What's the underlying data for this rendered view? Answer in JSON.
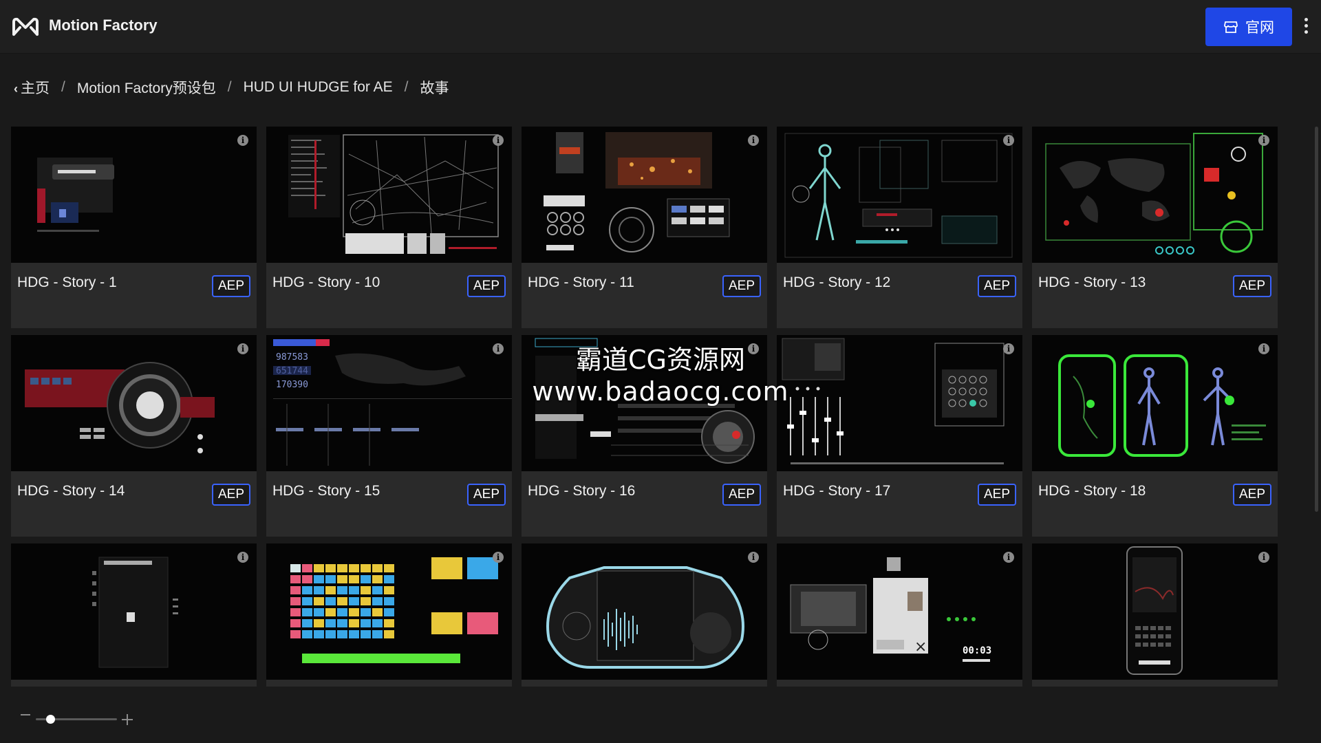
{
  "app": {
    "title": "Motion Factory",
    "logo_icon": "motion-factory-logo-icon",
    "site_button": {
      "label": "官网",
      "icon": "store-icon"
    },
    "more_icon": "kebab-menu-icon"
  },
  "breadcrumb": {
    "back_icon": "chevron-left-icon",
    "items": [
      "主页",
      "Motion Factory预设包",
      "HUD UI HUDGE for AE",
      "故事"
    ],
    "separator": "/"
  },
  "cards": [
    {
      "title": "HDG - Story - 1",
      "badge": "AEP"
    },
    {
      "title": "HDG - Story - 10",
      "badge": "AEP"
    },
    {
      "title": "HDG - Story - 11",
      "badge": "AEP"
    },
    {
      "title": "HDG - Story - 12",
      "badge": "AEP"
    },
    {
      "title": "HDG - Story - 13",
      "badge": "AEP"
    },
    {
      "title": "HDG - Story - 14",
      "badge": "AEP"
    },
    {
      "title": "HDG - Story - 15",
      "badge": "AEP"
    },
    {
      "title": "HDG - Story - 16",
      "badge": "AEP"
    },
    {
      "title": "HDG - Story - 17",
      "badge": "AEP"
    },
    {
      "title": "HDG - Story - 18",
      "badge": "AEP"
    },
    {
      "title": "",
      "badge": ""
    },
    {
      "title": "",
      "badge": ""
    },
    {
      "title": "",
      "badge": ""
    },
    {
      "title": "",
      "badge": ""
    },
    {
      "title": "",
      "badge": ""
    }
  ],
  "thumb_text": {
    "card15": [
      "987583",
      "651744",
      "170390"
    ],
    "card20_time": "00:03"
  },
  "watermark": {
    "line1": "霸道CG资源网",
    "line2": "www.badaocg.com"
  },
  "zoom": {
    "level": 0.18
  },
  "colors": {
    "accent": "#1f47e6",
    "badge_border": "#3a63ff",
    "background": "#1a1a1a",
    "card": "#2a2a2a"
  }
}
